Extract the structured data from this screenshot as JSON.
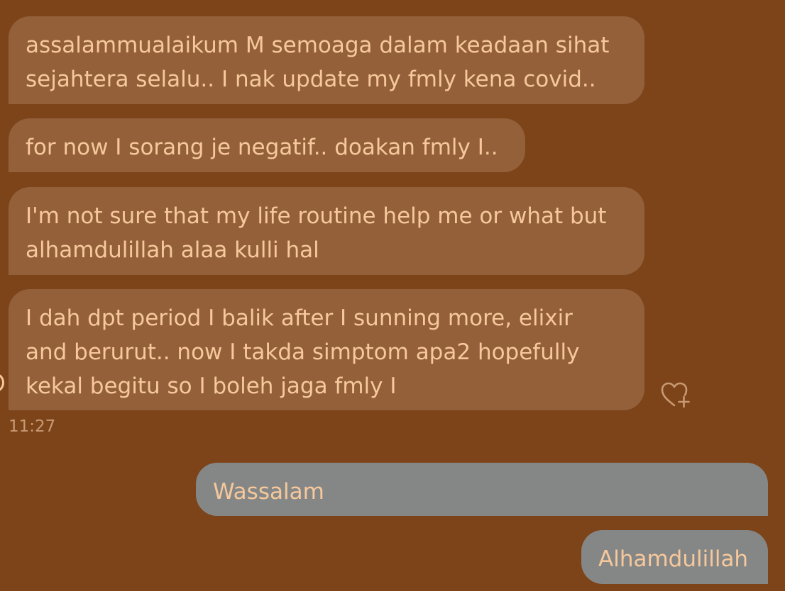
{
  "messages": {
    "received": [
      {
        "text": "assalammualaikum M semoaga dalam keadaan sihat\nsejahtera selalu.. I nak update my fmly kena covid.."
      },
      {
        "text": "for now I sorang je negatif.. doakan fmly I.."
      },
      {
        "text": "I'm not sure that my life routine help me or what but\nalhamdulillah alaa kulli hal"
      },
      {
        "text": "I dah dpt period I balik after I sunning more, elixir\nand berurut.. now I takda simptom apa2 hopefully\nkekal begitu so I boleh jaga fmly I"
      }
    ],
    "timestamp": "11:27",
    "sent": [
      {
        "text": "Wassalam"
      },
      {
        "text": "Alhamdulillah"
      }
    ]
  },
  "icons": {
    "react": "heart-plus-icon"
  },
  "colors": {
    "background": "#7d4319",
    "received_bubble": "#93603a",
    "sent_bubble": "#858787",
    "text": "#f6c89b",
    "timestamp": "#c89a74"
  }
}
